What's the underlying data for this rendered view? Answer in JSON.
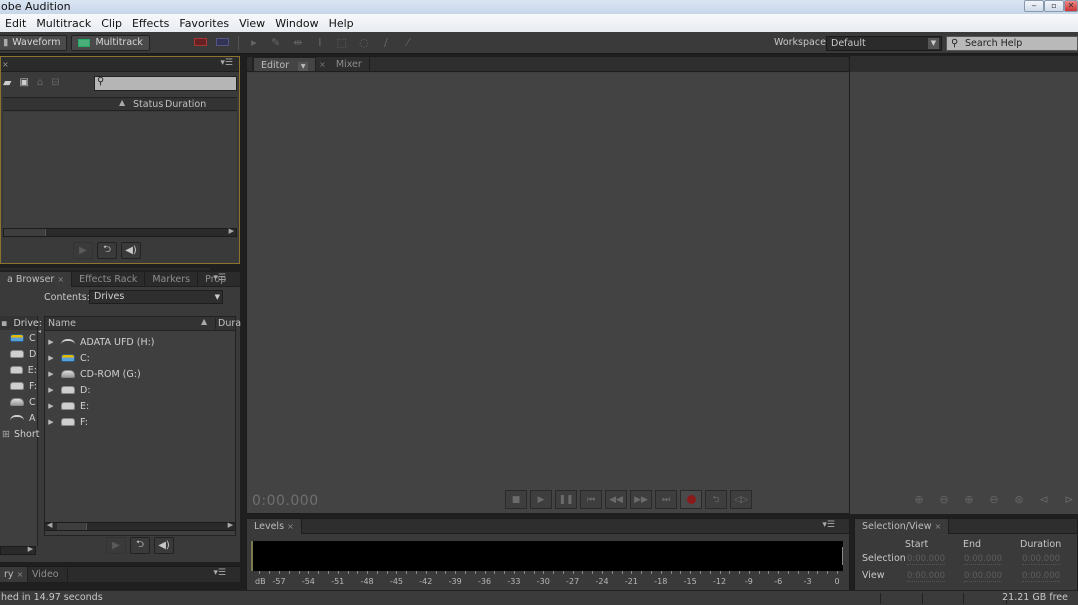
{
  "window": {
    "title": "obe Audition",
    "min_label": "‒",
    "max_label": "▫",
    "close_label": "✕"
  },
  "menu": [
    "Edit",
    "Multitrack",
    "Clip",
    "Effects",
    "Favorites",
    "View",
    "Window",
    "Help"
  ],
  "toolbar": {
    "waveform_label": "Waveform",
    "multitrack_label": "Multitrack",
    "workspace_label": "Workspace:",
    "workspace_value": "Default",
    "search_placeholder": "Search Help",
    "tools": [
      "move-tool",
      "razor-tool",
      "slip-tool",
      "time-selection-tool",
      "marquee-tool",
      "lasso-tool",
      "brush-tool",
      "spot-healing-tool"
    ]
  },
  "files_panel": {
    "columns": {
      "status": "Status",
      "duration": "Duration"
    },
    "search_value": ""
  },
  "media_browser": {
    "tabs": [
      "a Browser",
      "Effects Rack",
      "Markers",
      "Prop"
    ],
    "contents_label": "Contents:",
    "contents_value": "Drives",
    "tree_left": [
      {
        "label": "Drive:",
        "icon": "folder"
      },
      {
        "label": "C",
        "icon": "system-drive"
      },
      {
        "label": "D",
        "icon": "drive"
      },
      {
        "label": "E:",
        "icon": "drive"
      },
      {
        "label": "F:",
        "icon": "drive"
      },
      {
        "label": "C",
        "icon": "cd-drive"
      },
      {
        "label": "A",
        "icon": "usb-drive"
      },
      {
        "label": "Short",
        "icon": "shortcut"
      }
    ],
    "columns": {
      "name": "Name",
      "duration": "Dura"
    },
    "drives": [
      {
        "label": "ADATA UFD (H:)",
        "icon": "usb"
      },
      {
        "label": "C:",
        "icon": "sys"
      },
      {
        "label": "CD-ROM (G:)",
        "icon": "cd"
      },
      {
        "label": "D:",
        "icon": "hdd"
      },
      {
        "label": "E:",
        "icon": "hdd"
      },
      {
        "label": "F:",
        "icon": "hdd"
      }
    ]
  },
  "history_tabs": [
    "ry",
    "Video"
  ],
  "editor": {
    "tabs": [
      "Editor",
      "Mixer"
    ],
    "timecode": "0:00.000"
  },
  "levels": {
    "tab": "Levels",
    "unit": "dB",
    "scale": [
      "-57",
      "-54",
      "-51",
      "-48",
      "-45",
      "-42",
      "-39",
      "-36",
      "-33",
      "-30",
      "-27",
      "-24",
      "-21",
      "-18",
      "-15",
      "-12",
      "-9",
      "-6",
      "-3",
      "0"
    ]
  },
  "selection_view": {
    "tab": "Selection/View",
    "headers": [
      "Start",
      "End",
      "Duration"
    ],
    "rows": [
      {
        "label": "Selection",
        "values": [
          "0:00.000",
          "0:00.000",
          "0:00.000"
        ]
      },
      {
        "label": "View",
        "values": [
          "0:00.000",
          "0:00.000",
          "0:00.000"
        ]
      }
    ]
  },
  "status": {
    "message": "hed in 14.97 seconds",
    "free_space": "21.21 GB free"
  },
  "colors": {
    "record": "#8b1a1a",
    "active_panel_border": "#8a7430"
  }
}
